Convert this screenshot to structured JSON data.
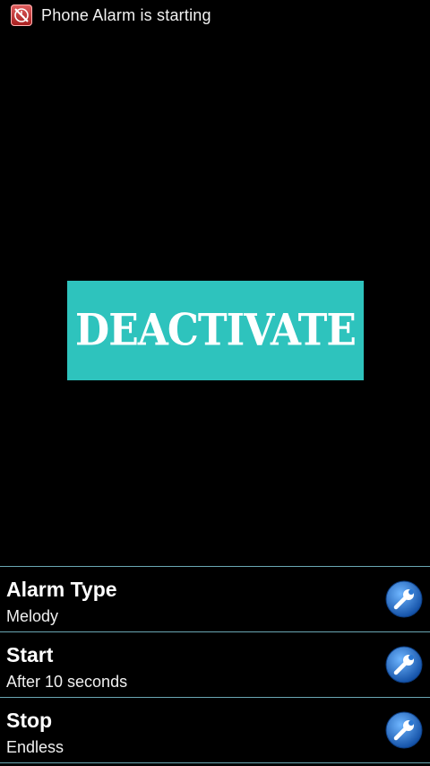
{
  "status_bar": {
    "icon": "alarm-off-icon",
    "text": "Phone Alarm is starting"
  },
  "deactivate_button": {
    "label": "DEACTIVATE",
    "color": "#2ec3bd"
  },
  "settings": [
    {
      "title": "Alarm Type",
      "value": "Melody",
      "icon": "wrench-icon"
    },
    {
      "title": "Start",
      "value": "After 10 seconds",
      "icon": "wrench-icon"
    },
    {
      "title": "Stop",
      "value": "Endless",
      "icon": "wrench-icon"
    }
  ]
}
